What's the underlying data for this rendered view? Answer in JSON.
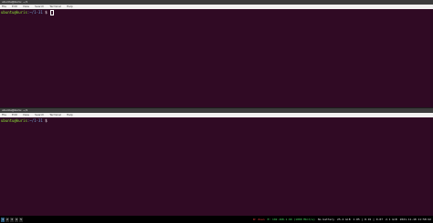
{
  "top_terminal": {
    "title": "ubuntu@kuris: ~/1",
    "menu": [
      "File",
      "Edit",
      "View",
      "Search",
      "Terminal",
      "Help"
    ],
    "prompt": {
      "userhost": "ubuntu@kuris",
      "path": ":~/1-31",
      "symbol": "$"
    }
  },
  "bottom_terminal": {
    "title": "ubuntu@kuris: ~/1",
    "menu": [
      "File",
      "Edit",
      "View",
      "Search",
      "Terminal",
      "Help"
    ],
    "prompt": {
      "userhost": "ubuntu@kuris",
      "path": ":~/1-31",
      "symbol": "$"
    }
  },
  "statusbar": {
    "workspaces": [
      "1",
      "2",
      "3",
      "4",
      "5"
    ],
    "active_workspace": "1",
    "items": [
      {
        "text": "W: down",
        "color": "#ff4040"
      },
      {
        "text": "E: 192.168.1.99 (1000 Mbit/s)",
        "color": "#4cd964"
      },
      {
        "text": "No battery",
        "color": "#e0e0e0"
      },
      {
        "text": "25.2 GiB",
        "color": "#e0e0e0"
      },
      {
        "text": "1.05 | 0.91 | 0.87",
        "color": "#e0e0e0"
      },
      {
        "text": "2.1 GiB",
        "color": "#e0e0e0"
      },
      {
        "text": "2021-11-18 11:58:22",
        "color": "#e0e0e0"
      }
    ]
  }
}
